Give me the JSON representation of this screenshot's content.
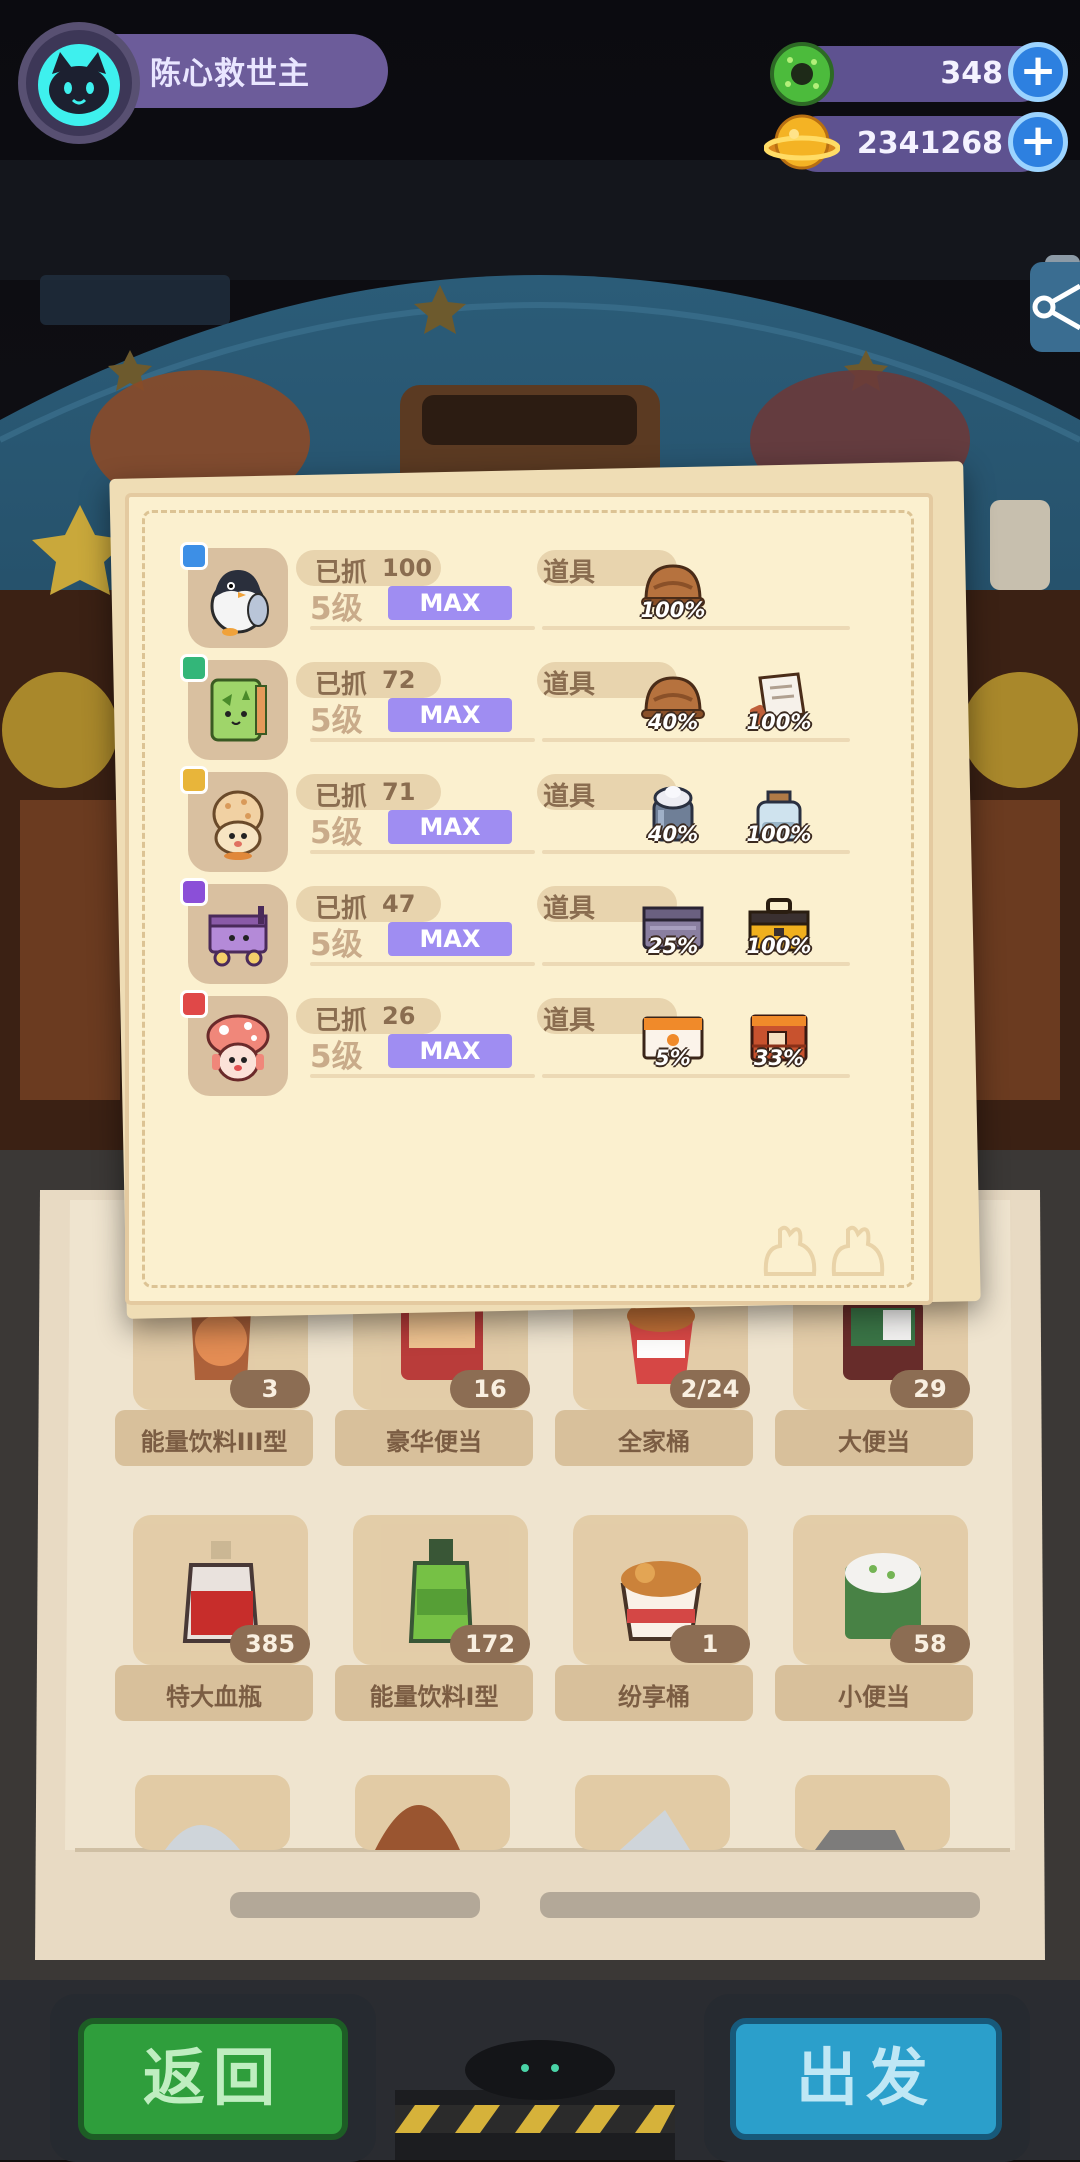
{
  "player": {
    "name": "陈心救世主"
  },
  "currencies": [
    {
      "icon": "green-donut-icon",
      "value": "348"
    },
    {
      "icon": "gold-coin-planet-icon",
      "value": "2341268"
    }
  ],
  "modal": {
    "rows": [
      {
        "creature": "penguin-creature-icon",
        "rarity_color": "#3d8fe6",
        "caught_label": "已抓",
        "caught": "100",
        "level": "5级",
        "max_label": "MAX",
        "props_label": "道具",
        "props": [
          {
            "icon": "helmet-icon",
            "percent": "100%"
          }
        ]
      },
      {
        "creature": "book-creature-icon",
        "rarity_color": "#33b679",
        "caught_label": "已抓",
        "caught": "72",
        "level": "5级",
        "max_label": "MAX",
        "props_label": "道具",
        "props": [
          {
            "icon": "helmet-icon",
            "percent": "40%"
          },
          {
            "icon": "scroll-icon",
            "percent": "100%"
          }
        ]
      },
      {
        "creature": "cookie-creature-icon",
        "rarity_color": "#e8b53a",
        "caught_label": "已抓",
        "caught": "71",
        "level": "5级",
        "max_label": "MAX",
        "props_label": "道具",
        "props": [
          {
            "icon": "ice-jar-icon",
            "percent": "40%"
          },
          {
            "icon": "glass-jar-icon",
            "percent": "100%"
          }
        ]
      },
      {
        "creature": "cart-creature-icon",
        "rarity_color": "#8b4fd8",
        "caught_label": "已抓",
        "caught": "47",
        "level": "5级",
        "max_label": "MAX",
        "props_label": "道具",
        "props": [
          {
            "icon": "metal-box-icon",
            "percent": "25%"
          },
          {
            "icon": "tool-chest-icon",
            "percent": "100%"
          }
        ]
      },
      {
        "creature": "mushroom-creature-icon",
        "rarity_color": "#e04848",
        "caught_label": "已抓",
        "caught": "26",
        "level": "5级",
        "max_label": "MAX",
        "props_label": "道具",
        "props": [
          {
            "icon": "orange-box-icon",
            "percent": "5%"
          },
          {
            "icon": "red-crate-icon",
            "percent": "33%"
          }
        ]
      }
    ]
  },
  "inventory": {
    "rows": [
      [
        {
          "name": "能量饮料III型",
          "count": "3",
          "icon": "energy-drink-iii-icon"
        },
        {
          "name": "豪华便当",
          "count": "16",
          "icon": "deluxe-bento-icon"
        },
        {
          "name": "全家桶",
          "count": "2/24",
          "icon": "family-bucket-icon"
        },
        {
          "name": "大便当",
          "count": "29",
          "icon": "big-bento-icon"
        }
      ],
      [
        {
          "name": "特大血瓶",
          "count": "385",
          "icon": "large-health-potion-icon"
        },
        {
          "name": "能量饮料I型",
          "count": "172",
          "icon": "energy-drink-i-icon"
        },
        {
          "name": "纷享桶",
          "count": "1",
          "icon": "share-bucket-icon"
        },
        {
          "name": "小便当",
          "count": "58",
          "icon": "small-bento-icon"
        }
      ]
    ]
  },
  "buttons": {
    "back": "返回",
    "go": "出发"
  },
  "colors": {
    "max_badge": "#9f8df2",
    "paper": "#fbf0cf",
    "back_button": "#2f9e3c",
    "go_button": "#2b9fcb"
  }
}
